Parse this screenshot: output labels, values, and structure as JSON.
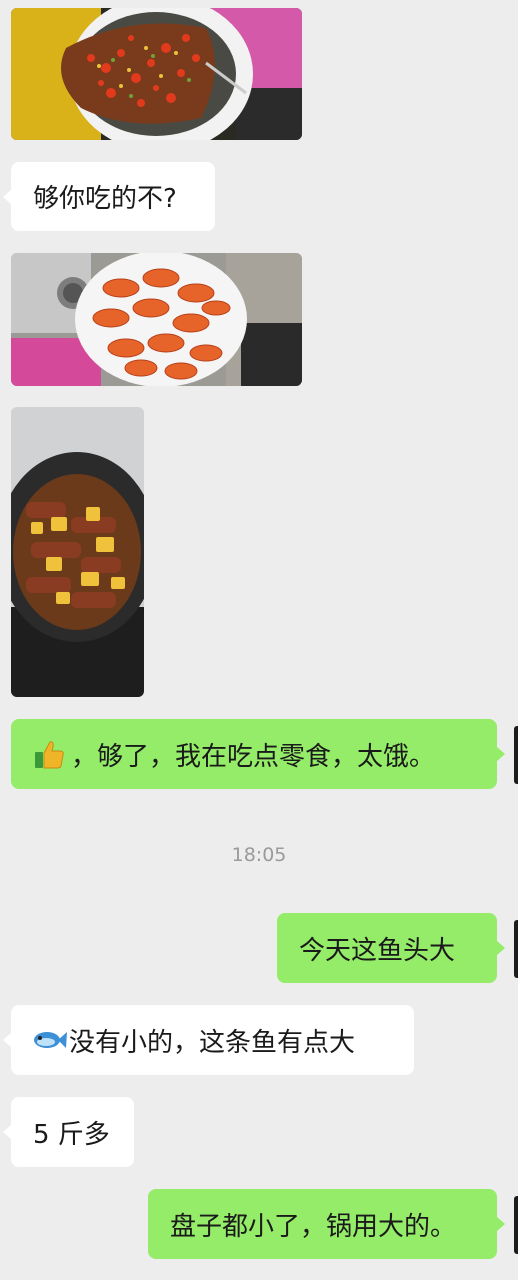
{
  "chat": {
    "timestamp": "18:05",
    "messages": [
      {
        "side": "in",
        "type": "image",
        "icon": "fish-head-dish-photo"
      },
      {
        "side": "in",
        "type": "text",
        "text": "够你吃的不?"
      },
      {
        "side": "in",
        "type": "image",
        "icon": "shrimp-plate-photo"
      },
      {
        "side": "in",
        "type": "image",
        "icon": "braised-meat-wok-photo"
      },
      {
        "side": "out",
        "type": "text",
        "emoji": "thumbs-up-icon",
        "text": "，够了，我在吃点零食，太饿。"
      },
      {
        "side": "out",
        "type": "text",
        "text": "今天这鱼头大"
      },
      {
        "side": "in",
        "type": "text",
        "emoji": "fish-icon",
        "text": "没有小的，这条鱼有点大"
      },
      {
        "side": "in",
        "type": "text",
        "text": "5 斤多"
      },
      {
        "side": "out",
        "type": "text",
        "text": "盘子都小了，锅用大的。"
      }
    ]
  },
  "colors": {
    "background": "#ededed",
    "incoming_bubble": "#ffffff",
    "outgoing_bubble": "#95ec69",
    "timestamp_text": "#9a9a9a"
  }
}
